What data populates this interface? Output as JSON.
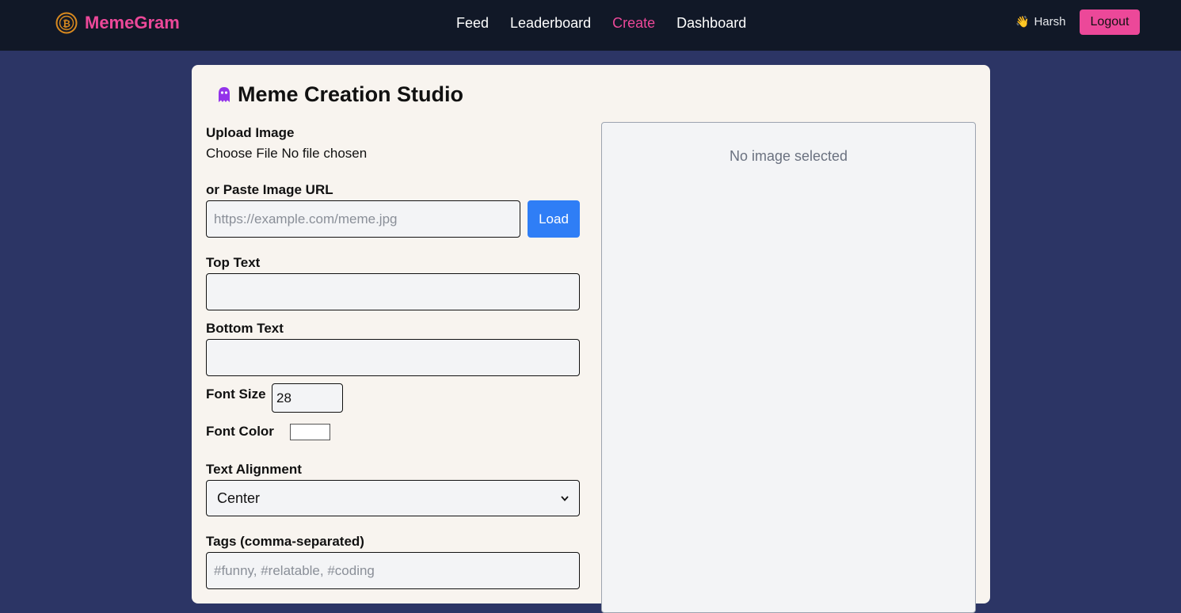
{
  "nav": {
    "brand": "MemeGram",
    "brand_icon": "bitcoin-coin-icon",
    "links": [
      "Feed",
      "Leaderboard",
      "Create",
      "Dashboard"
    ],
    "active_link": "Create",
    "user_greeting_icon": "👋",
    "user_name": "Harsh",
    "logout_label": "Logout"
  },
  "studio": {
    "title_icon": "ghost-icon",
    "title": "Meme Creation Studio",
    "upload_label": "Upload Image",
    "choose_file_label": "Choose File",
    "no_file_label": "No file chosen",
    "url_label": "or Paste Image URL",
    "url_placeholder": "https://example.com/meme.jpg",
    "url_value": "",
    "load_label": "Load",
    "top_text_label": "Top Text",
    "top_text_value": "",
    "bottom_text_label": "Bottom Text",
    "bottom_text_value": "",
    "font_size_label": "Font Size",
    "font_size_value": "28",
    "font_color_label": "Font Color",
    "font_color_value": "#ffffff",
    "alignment_label": "Text Alignment",
    "alignment_value": "Center",
    "tags_label": "Tags (comma-separated)",
    "tags_placeholder": "#funny, #relatable, #coding",
    "tags_value": ""
  },
  "preview": {
    "empty_message": "No image selected"
  },
  "colors": {
    "accent_pink": "#ec4899",
    "button_blue": "#2f7ef6",
    "nav_bg": "#111827",
    "page_bg": "#2c3565",
    "card_bg": "#f8f4ef"
  }
}
